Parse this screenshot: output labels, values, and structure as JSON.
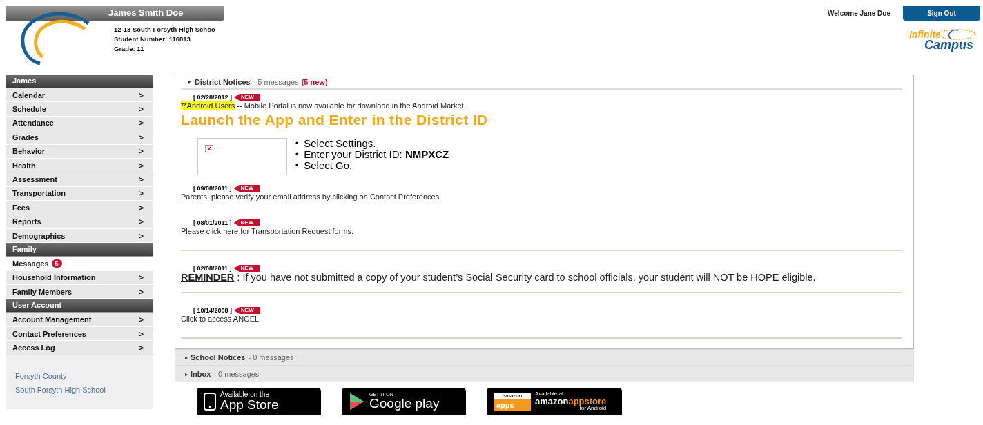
{
  "header": {
    "student_name": "James Smith Doe",
    "school_line": "12-13 South Forsyth High Schoo",
    "student_number": "Student Number: 116813",
    "grade": "Grade: 11",
    "welcome": "Welcome Jane Doe",
    "sign_out": "Sign Out",
    "logo_top": "Infinite",
    "logo_bottom": "Campus"
  },
  "sidebar": {
    "items": [
      {
        "kind": "header",
        "label": "James"
      },
      {
        "kind": "item",
        "label": "Calendar",
        "arrow": ">",
        "selected": false
      },
      {
        "kind": "item",
        "label": "Schedule",
        "arrow": ">",
        "selected": false
      },
      {
        "kind": "item",
        "label": "Attendance",
        "arrow": ">",
        "selected": false
      },
      {
        "kind": "item",
        "label": "Grades",
        "arrow": ">",
        "selected": false
      },
      {
        "kind": "item",
        "label": "Behavior",
        "arrow": ">",
        "selected": false
      },
      {
        "kind": "item",
        "label": "Health",
        "arrow": ">",
        "selected": false
      },
      {
        "kind": "item",
        "label": "Assessment",
        "arrow": ">",
        "selected": false
      },
      {
        "kind": "item",
        "label": "Transportation",
        "arrow": ">",
        "selected": false
      },
      {
        "kind": "item",
        "label": "Fees",
        "arrow": ">",
        "selected": false
      },
      {
        "kind": "item",
        "label": "Reports",
        "arrow": ">",
        "selected": false
      },
      {
        "kind": "item",
        "label": "Demographics",
        "arrow": ">",
        "selected": false
      },
      {
        "kind": "header",
        "label": "Family"
      },
      {
        "kind": "item",
        "label": "Messages",
        "badge": "5",
        "selected": true
      },
      {
        "kind": "item",
        "label": "Household Information",
        "arrow": ">",
        "selected": false
      },
      {
        "kind": "item",
        "label": "Family Members",
        "arrow": ">",
        "selected": false
      },
      {
        "kind": "header",
        "label": "User Account"
      },
      {
        "kind": "item",
        "label": "Account Management",
        "arrow": ">",
        "selected": false
      },
      {
        "kind": "item",
        "label": "Contact Preferences",
        "arrow": ">",
        "selected": false
      },
      {
        "kind": "item",
        "label": "Access Log",
        "arrow": ">",
        "selected": false
      }
    ],
    "links": [
      "Forsyth County",
      "South Forsyth High School"
    ]
  },
  "sections": [
    {
      "caret": "▼",
      "title": "District Notices",
      "count": "- 5 messages",
      "new_count": "(5 new)",
      "expanded": true,
      "messages": [
        {
          "kind": "announcement",
          "date": "[ 02/28/2012 ]",
          "new_label": "NEW",
          "highlight": "**Android Users",
          "text": "-- Mobile Portal is now available for download in the  Android Market.",
          "headline": "Launch the App and Enter in the District ID",
          "bullets": [
            {
              "mark": "•",
              "text": "Select Settings."
            },
            {
              "mark": "•",
              "text": "Enter your District ID:  **NMPXCZ**"
            },
            {
              "mark": "•",
              "text": "Select Go."
            }
          ]
        },
        {
          "kind": "notice",
          "date": "[ 09/08/2011 ]",
          "new_label": "NEW",
          "text": "Parents, please verify your email address by clicking on Contact Preferences."
        },
        {
          "kind": "notice",
          "date": "[ 08/01/2011 ]",
          "new_label": "NEW",
          "text": "Please  click here for Transportation Request forms."
        },
        {
          "kind": "rule"
        },
        {
          "kind": "reminder",
          "date": "[ 02/08/2011 ]",
          "new_label": "NEW",
          "lead": "REMINDER",
          "text": " :  If you have not submitted a copy of your student’s Social Security card to school officials, your student will NOT be HOPE eligible."
        },
        {
          "kind": "rule"
        },
        {
          "kind": "notice",
          "date": "[ 10/14/2008 ]",
          "new_label": "NEW",
          "text": "Click to access ANGEL."
        },
        {
          "kind": "rule"
        }
      ]
    },
    {
      "caret": "▸",
      "title": "School Notices",
      "count": "- 0 messages",
      "expanded": false
    },
    {
      "caret": "▸",
      "title": "Inbox",
      "count": "- 0 messages",
      "expanded": false
    }
  ],
  "store_badges": [
    {
      "kind": "apple",
      "small": "Available on the",
      "big": "App Store"
    },
    {
      "kind": "google",
      "small": "GET IT ON",
      "big": "Google play"
    },
    {
      "kind": "amazon",
      "tag_top": "amazon",
      "tag_bottom": "apps",
      "small": "Available at",
      "big_a": "amazon",
      "big_b": "appstore",
      "sub": "for Android"
    }
  ]
}
